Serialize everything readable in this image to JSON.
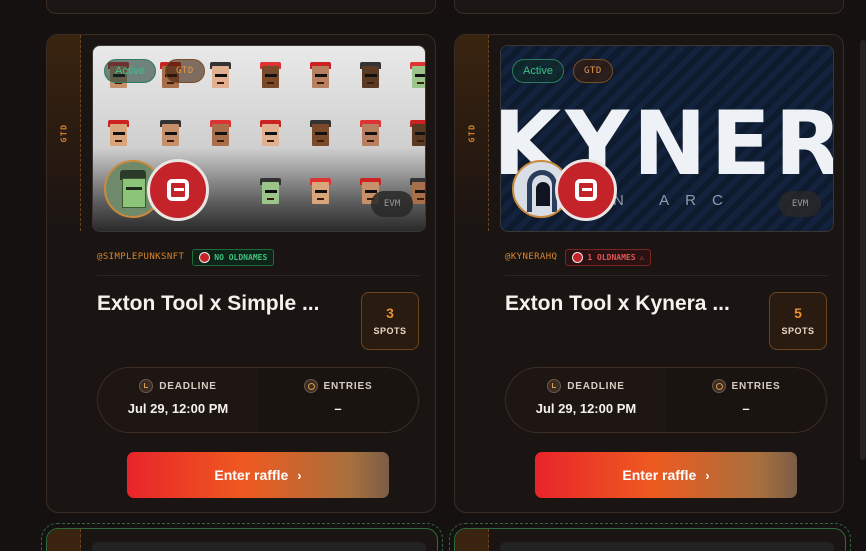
{
  "cards": [
    {
      "side_tag": "GTD",
      "status": "Active",
      "type_chip": "GTD",
      "chain": "EVM",
      "handle": "@SIMPLEPUNKSNFT",
      "oldnames": "NO OLDNAMES",
      "title": "Exton Tool x Simple ...",
      "spots_count": "3",
      "spots_label": "SPOTS",
      "deadline_label": "DEADLINE",
      "deadline_value": "Jul 29, 12:00 PM",
      "entries_label": "ENTRIES",
      "entries_value": "–",
      "button_label": "Enter raffle"
    },
    {
      "side_tag": "GTD",
      "status": "Active",
      "type_chip": "GTD",
      "chain": "EVM",
      "handle": "@KYNERAHQ",
      "oldnames": "1 OLDNAMES",
      "title": "Exton Tool x Kynera ...",
      "spots_count": "5",
      "spots_label": "SPOTS",
      "deadline_label": "DEADLINE",
      "deadline_value": "Jul 29, 12:00 PM",
      "entries_label": "ENTRIES",
      "entries_value": "–",
      "button_label": "Enter raffle",
      "banner_text": "KYNERA",
      "banner_subtext": "N ARC"
    }
  ],
  "colors": {
    "accent": "#d9842c",
    "active_green": "#3fc08c",
    "brand_red": "#c4232a",
    "warn_red": "#e05555"
  },
  "icons": [
    "clock-icon",
    "users-icon",
    "chevron-right-icon",
    "warning-icon",
    "exton-logo"
  ]
}
